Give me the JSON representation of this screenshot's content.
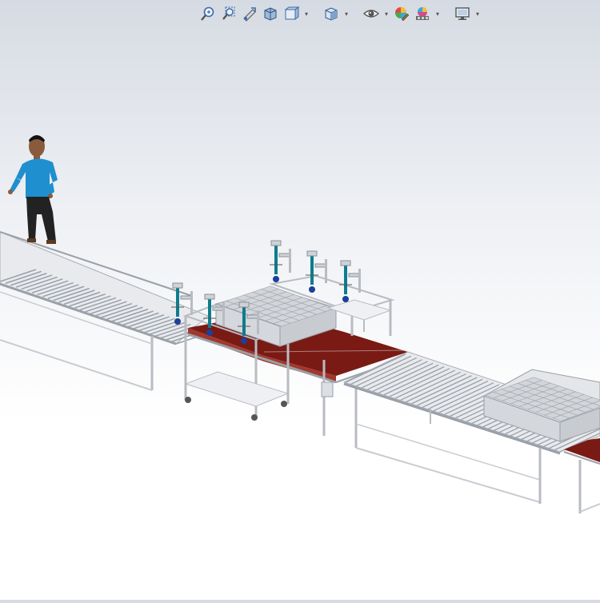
{
  "toolbar": {
    "buttons": [
      {
        "name": "zoom-to-fit-icon"
      },
      {
        "name": "zoom-to-area-icon"
      },
      {
        "name": "previous-view-icon"
      },
      {
        "name": "section-view-icon"
      },
      {
        "name": "dynamic-annotation-views-icon",
        "dropdown": true
      },
      {
        "name": "view-orientation-icon",
        "dropdown": true
      },
      {
        "name": "hide-show-items-icon",
        "dropdown": true
      },
      {
        "name": "edit-appearance-icon"
      },
      {
        "name": "apply-scene-icon",
        "dropdown": true
      },
      {
        "name": "view-settings-icon",
        "dropdown": true
      }
    ],
    "dropdown_glyph": "▾"
  },
  "scene": {
    "colors": {
      "frame": "#c8ccd2",
      "frame_dark": "#9aa0a8",
      "roller": "#dfe2e6",
      "belt": "#7a1a14",
      "belt_light": "#a2382c",
      "shirt": "#1f8fcf",
      "pants": "#222222",
      "skin": "#8a5a3c",
      "teal": "#0e7c8c"
    }
  }
}
